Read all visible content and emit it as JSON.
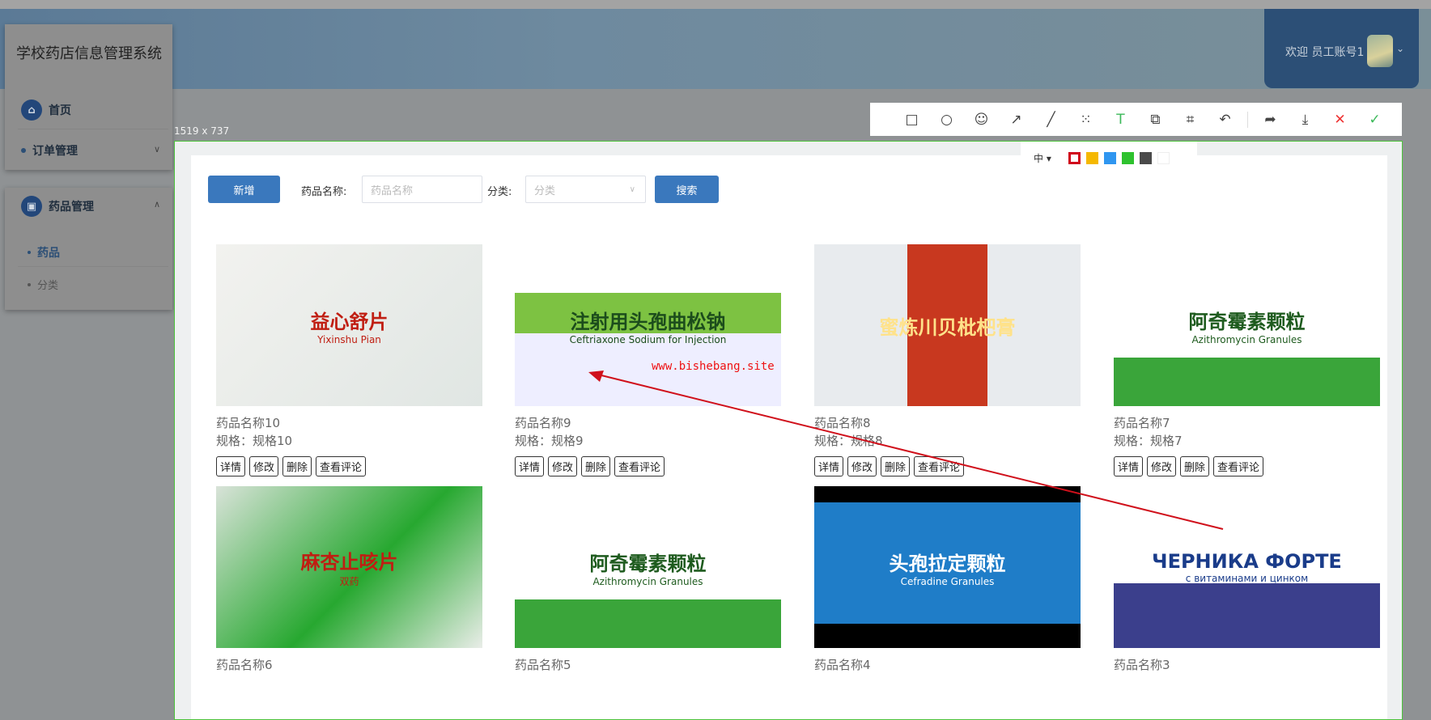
{
  "app": {
    "title": "学校药店信息管理系统",
    "welcome": "欢迎 员工账号1"
  },
  "sidebar": {
    "items": [
      {
        "label": "首页"
      },
      {
        "label": "订单管理"
      },
      {
        "label": "药品管理"
      },
      {
        "label": "药品"
      },
      {
        "label": "分类"
      }
    ]
  },
  "capture": {
    "size": "1519 x 737",
    "font_size": "中 ▾",
    "watermark": "www.bishebang.site",
    "colors": [
      "#d0021b",
      "#f5b800",
      "#2f96f0",
      "#2ec22e",
      "#4a4a4a",
      "#ffffff"
    ]
  },
  "toolbar": {
    "tools": [
      "rectangle-icon",
      "ellipse-icon",
      "emoji-icon",
      "arrow-icon",
      "pen-icon",
      "mosaic-icon",
      "text-icon",
      "pin-icon",
      "ocr-icon",
      "undo-icon",
      "share-icon",
      "save-icon",
      "cancel-icon",
      "confirm-icon"
    ]
  },
  "filters": {
    "add": "新增",
    "name_label": "药品名称:",
    "name_placeholder": "药品名称",
    "category_label": "分类:",
    "category_placeholder": "分类",
    "search": "搜索"
  },
  "actions": {
    "detail": "详情",
    "edit": "修改",
    "delete": "删除",
    "reviews": "查看评论"
  },
  "products": [
    {
      "name": "药品名称10",
      "spec": "规格：规格10",
      "img_title": "益心舒片",
      "img_sub": "Yixinshu Pian"
    },
    {
      "name": "药品名称9",
      "spec": "规格：规格9",
      "img_title": "注射用头孢曲松钠",
      "img_sub": "Ceftriaxone Sodium for Injection"
    },
    {
      "name": "药品名称8",
      "spec": "规格：规格8",
      "img_title": "蜜炼川贝枇杷膏",
      "img_sub": ""
    },
    {
      "name": "药品名称7",
      "spec": "规格：规格7",
      "img_title": "阿奇霉素颗粒",
      "img_sub": "Azithromycin Granules"
    },
    {
      "name": "药品名称6",
      "spec": "",
      "img_title": "麻杏止咳片",
      "img_sub": "双药"
    },
    {
      "name": "药品名称5",
      "spec": "",
      "img_title": "阿奇霉素颗粒",
      "img_sub": "Azithromycin Granules"
    },
    {
      "name": "药品名称4",
      "spec": "",
      "img_title": "头孢拉定颗粒",
      "img_sub": "Cefradine Granules"
    },
    {
      "name": "药品名称3",
      "spec": "",
      "img_title": "ЧЕРНИКА ФОРТЕ",
      "img_sub": "с витаминами и цинком"
    }
  ]
}
